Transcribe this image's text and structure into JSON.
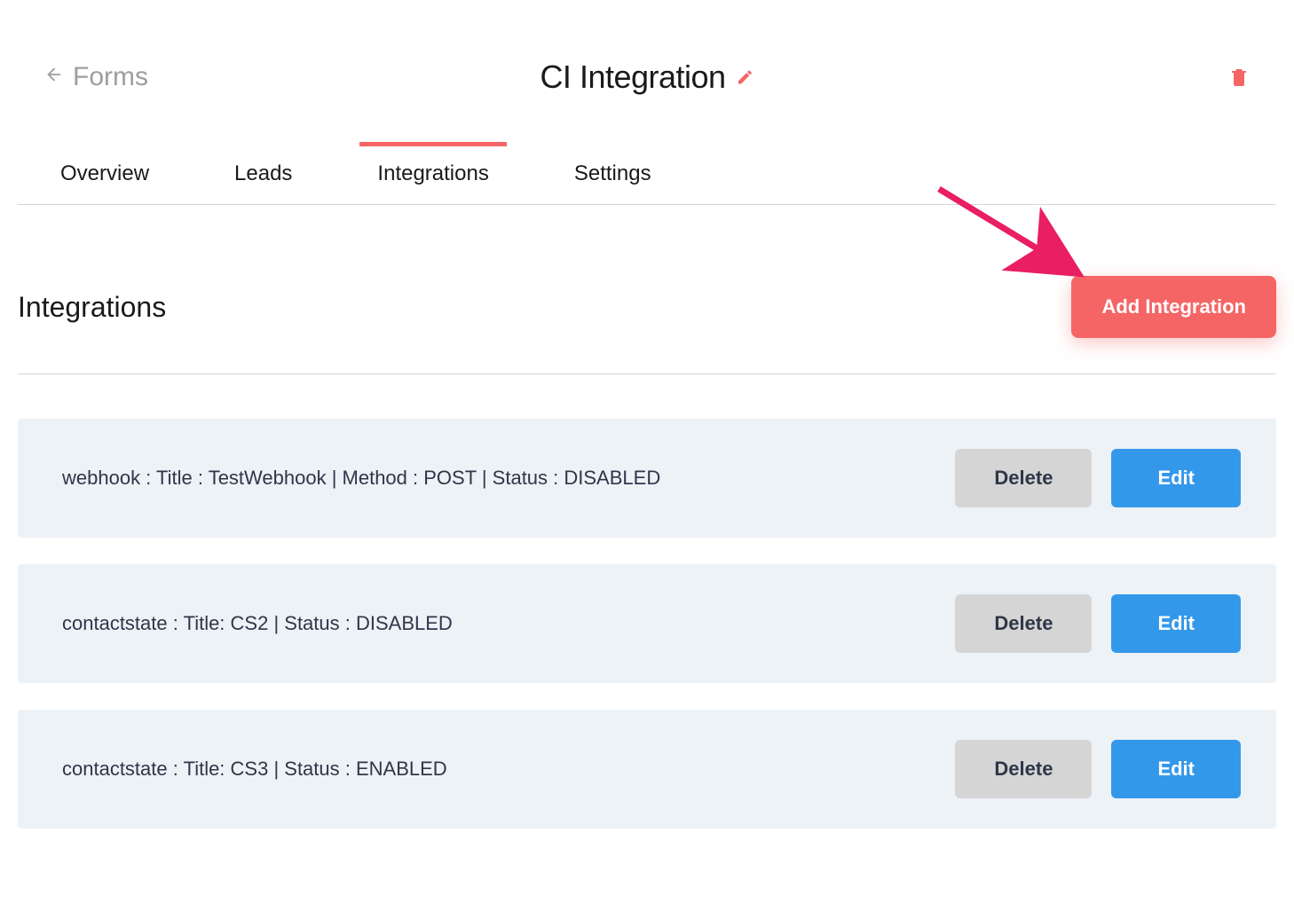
{
  "breadcrumb": {
    "label": "Forms"
  },
  "title": "CI Integration",
  "tabs": [
    {
      "label": "Overview",
      "active": false
    },
    {
      "label": "Leads",
      "active": false
    },
    {
      "label": "Integrations",
      "active": true
    },
    {
      "label": "Settings",
      "active": false
    }
  ],
  "section": {
    "title": "Integrations",
    "add_button": "Add Integration"
  },
  "integrations": [
    {
      "text": "webhook : Title : TestWebhook | Method : POST | Status : DISABLED",
      "delete": "Delete",
      "edit": "Edit"
    },
    {
      "text": "contactstate : Title: CS2 | Status : DISABLED",
      "delete": "Delete",
      "edit": "Edit"
    },
    {
      "text": "contactstate : Title: CS3 | Status : ENABLED",
      "delete": "Delete",
      "edit": "Edit"
    }
  ],
  "colors": {
    "accent": "#f56565",
    "primary": "#3498ea",
    "panel": "#edf2f7"
  }
}
